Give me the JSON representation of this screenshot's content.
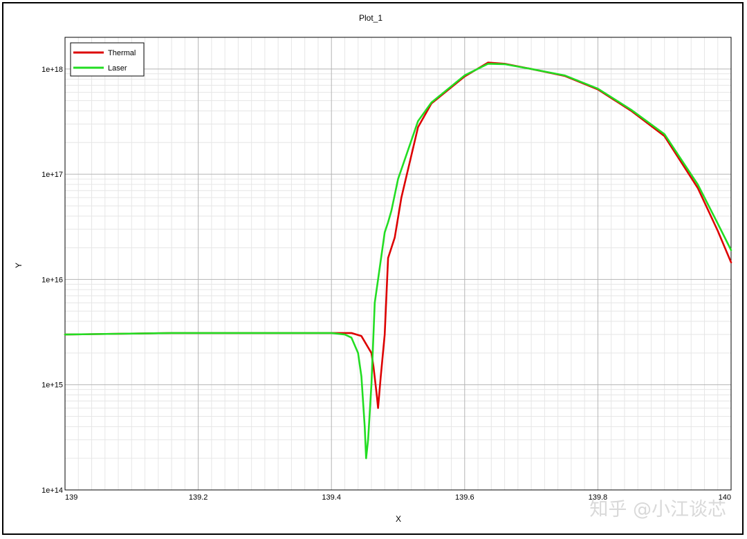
{
  "watermark": "知乎 @小江谈芯",
  "colors": {
    "thermal": "#dd0000",
    "laser": "#22dd22",
    "grid_major": "#b4b4b4",
    "grid_minor": "#e6e6e6",
    "watermark": "#d9d9d9"
  },
  "chart_data": {
    "type": "line",
    "title": "Plot_1",
    "xlabel": "X",
    "ylabel": "Y",
    "xlim": [
      139,
      140
    ],
    "ylim": [
      100000000000000.0,
      2e+18
    ],
    "yscale": "log",
    "grid": true,
    "legend": "top-left",
    "x_ticks": [
      {
        "value": 139,
        "label": "139"
      },
      {
        "value": 139.2,
        "label": "139.2"
      },
      {
        "value": 139.4,
        "label": "139.4"
      },
      {
        "value": 139.6,
        "label": "139.6"
      },
      {
        "value": 139.8,
        "label": "139.8"
      },
      {
        "value": 140,
        "label": "140"
      }
    ],
    "y_ticks": [
      {
        "value": 100000000000000.0,
        "label": "1e+14"
      },
      {
        "value": 1000000000000000.0,
        "label": "1e+15"
      },
      {
        "value": 1e+16,
        "label": "1e+16"
      },
      {
        "value": 1e+17,
        "label": "1e+17"
      },
      {
        "value": 1e+18,
        "label": "1e+18"
      }
    ],
    "series": [
      {
        "name": "Thermal",
        "color": "#dd0000",
        "x": [
          139,
          139.16,
          139.4,
          139.43,
          139.445,
          139.46,
          139.463,
          139.468,
          139.47,
          139.474,
          139.48,
          139.485,
          139.495,
          139.505,
          139.53,
          139.55,
          139.6,
          139.635,
          139.66,
          139.7,
          139.75,
          139.8,
          139.85,
          139.9,
          139.95,
          139.98,
          140
        ],
        "y": [
          3000000000000000.0,
          3100000000000000.0,
          3100000000000000.0,
          3100000000000000.0,
          2900000000000000.0,
          2000000000000000.0,
          1500000000000000.0,
          800000000000000.0,
          600000000000000.0,
          1200000000000000.0,
          3000000000000000.0,
          1.6e+16,
          2.5e+16,
          6e+16,
          2.8e+17,
          4.7e+17,
          8.5e+17,
          1.15e+18,
          1.12e+18,
          1e+18,
          8.6e+17,
          6.4e+17,
          4e+17,
          2.3e+17,
          7.4e+16,
          2.9e+16,
          1.45e+16
        ]
      },
      {
        "name": "Laser",
        "color": "#22dd22",
        "x": [
          139,
          139.16,
          139.4,
          139.42,
          139.43,
          139.44,
          139.445,
          139.45,
          139.452,
          139.455,
          139.46,
          139.465,
          139.47,
          139.48,
          139.485,
          139.49,
          139.5,
          139.53,
          139.55,
          139.6,
          139.635,
          139.66,
          139.7,
          139.75,
          139.8,
          139.85,
          139.9,
          139.95,
          139.98,
          140
        ],
        "y": [
          3000000000000000.0,
          3100000000000000.0,
          3100000000000000.0,
          3000000000000000.0,
          2800000000000000.0,
          2000000000000000.0,
          1200000000000000.0,
          400000000000000.0,
          200000000000000.0,
          300000000000000.0,
          1000000000000000.0,
          6000000000000000.0,
          1e+16,
          2.8e+16,
          3.5e+16,
          4.5e+16,
          9e+16,
          3.2e+17,
          4.8e+17,
          8.7e+17,
          1.12e+18,
          1.11e+18,
          1e+18,
          8.7e+17,
          6.5e+17,
          4.1e+17,
          2.4e+17,
          8e+16,
          3.4e+16,
          1.9e+16
        ]
      }
    ]
  }
}
